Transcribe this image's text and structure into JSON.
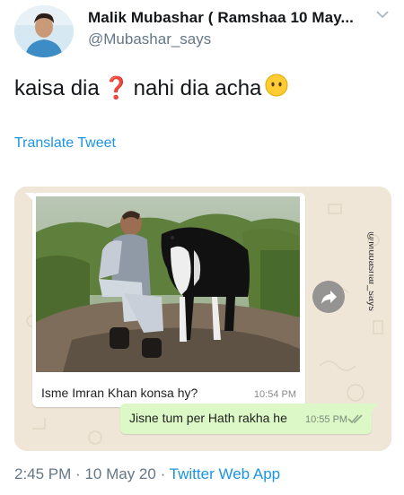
{
  "tweet": {
    "display_name": "Malik Mubashar ( Ramshaa 10 May...",
    "handle": "@Mubashar_says",
    "text_part1": "kaisa dia",
    "text_part2": "nahi dia acha",
    "emoji_question": "❓",
    "emoji_face": "😶",
    "translate_label": "Translate Tweet",
    "time": "2:45 PM",
    "date": "10 May 20",
    "separator": "·",
    "source": "Twitter Web App"
  },
  "chat": {
    "incoming_text": "Isme Imran Khan konsa hy?",
    "incoming_time": "10:54 PM",
    "outgoing_text": "Jisne tum per Hath rakha he",
    "outgoing_time": "10:55 PM",
    "watermark": "@Mubashar_says"
  },
  "icons": {
    "chevron": "chevron-down-icon",
    "forward": "forward-share-icon",
    "read_receipt": "double-check-icon"
  },
  "colors": {
    "link_blue": "#1b95e0",
    "secondary_text": "#657786",
    "outgoing_bubble": "#dcf8c6",
    "chat_background": "#efe6d8"
  }
}
